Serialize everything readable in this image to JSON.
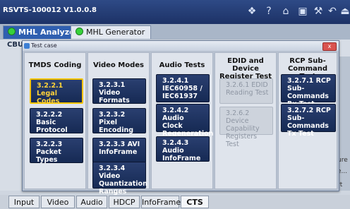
{
  "app": {
    "title": "RSVTS-100012 V1.0.0.8"
  },
  "toolbar_icons": [
    "windows-icon",
    "help-icon",
    "home-icon",
    "save-icon",
    "wrench-icon",
    "back-icon",
    "exit-icon"
  ],
  "app_tabs": [
    {
      "label": "MHL Analyzer",
      "active": true
    },
    {
      "label": "MHL Generator",
      "active": false
    }
  ],
  "background": {
    "cbu_label": "CBU",
    "side_labels": [
      "ure",
      "e...",
      "rt"
    ]
  },
  "bottom_tabs": [
    "Input",
    "Video",
    "Audio",
    "HDCP",
    "InfoFrame",
    "CTS"
  ],
  "dialog": {
    "title": "Test case",
    "close_label": "x",
    "columns": [
      {
        "header": "TMDS Coding",
        "buttons": [
          {
            "label": "3.2.2.1 Legal Codes",
            "state": "selected"
          },
          {
            "label": "3.2.2.2 Basic Protocol",
            "state": "normal"
          },
          {
            "label": "3.2.2.3 Packet Types",
            "state": "normal"
          }
        ]
      },
      {
        "header": "Video Modes",
        "buttons": [
          {
            "label": "3.2.3.1 Video Formats",
            "state": "normal"
          },
          {
            "label": "3.2.3.2 Pixel Encoding",
            "state": "normal"
          },
          {
            "label": "3.2.3.3 AVI InfoFrame",
            "state": "normal"
          },
          {
            "label": "3.2.3.4 Video Quantization Ranges",
            "state": "normal"
          }
        ]
      },
      {
        "header": "Audio Tests",
        "buttons": [
          {
            "label": "3.2.4.1 IEC60958 / IEC61937",
            "state": "normal"
          },
          {
            "label": "3.2.4.2 Audio Clock Regeneration",
            "state": "normal"
          },
          {
            "label": "3.2.4.3 Audio InfoFrame",
            "state": "normal"
          }
        ]
      },
      {
        "header": "EDID and Device Register Test",
        "buttons": [
          {
            "label": "3.2.6.1 EDID Reading Test",
            "state": "disabled"
          },
          {
            "label": "3.2.6.2 Device Capability Registers Test",
            "state": "disabled"
          }
        ]
      },
      {
        "header": "RCP Sub-Command Test",
        "buttons": [
          {
            "label": "3.2.7.1 RCP Sub-Commands Rx Test",
            "state": "normal"
          },
          {
            "label": "3.2.7.2 RCP Sub-Commands Tx Test",
            "state": "normal"
          }
        ]
      }
    ]
  }
}
